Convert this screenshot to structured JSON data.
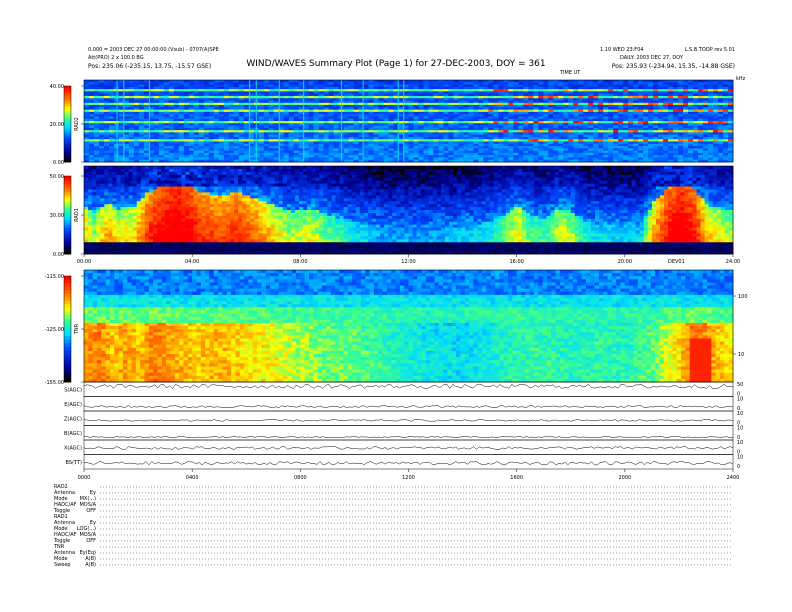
{
  "header": {
    "title": "WIND/WAVES Summary Plot (Page 1) for 27-DEC-2003, DOY = 361",
    "left_line1": "0.000 = 2003 DEC 27 00:00:00 (Vsub) - 0707(A)SPE",
    "left_line2": "Att(PRO) 2 x 100.0 BG",
    "left_pos": "Pos:    235.06 (-235.15, 13.75, -15.57 GSE)",
    "center_label": "TIME UT",
    "right_line1": "1.10 WED 23:F04",
    "right_line2": "DAILY: 2003 DEC 27, DOY",
    "right_pos": "Pos:    235.93 (-234.94, 15.35, -14.88 GSE)",
    "right_corner": "L.S.B.TOOP  rev 5.01",
    "right_unit": "kHz"
  },
  "chart_data": [
    {
      "type": "heatmap",
      "name": "RAD2",
      "ylabel": "RAD2",
      "yticks": [
        "40.00",
        "20.00",
        "0.00"
      ],
      "ylim": [
        0,
        40
      ],
      "features": {
        "horizontal_lines_frac": [
          0.12,
          0.2,
          0.28,
          0.36,
          0.5,
          0.6,
          0.72
        ],
        "vertical_streaks_hours": [
          1.2,
          1.45,
          2.4,
          6.1,
          6.35,
          7.2,
          8.1,
          9.5,
          10.3,
          11.6,
          11.8
        ]
      }
    },
    {
      "type": "heatmap",
      "name": "RAD1",
      "ylabel": "RAD1",
      "yticks": [
        "50.00",
        "30.00",
        "0.00"
      ],
      "ylim": [
        0,
        50
      ],
      "xticks": [
        "00:00",
        "04:00",
        "08:00",
        "12:00",
        "16:00",
        "20:00",
        "24:00"
      ],
      "xlim": [
        0,
        24
      ],
      "annotation": "DEV01",
      "intensity_profile": [
        [
          0.0,
          0.55
        ],
        [
          0.3,
          0.45
        ],
        [
          0.8,
          0.6
        ],
        [
          1.2,
          0.5
        ],
        [
          1.8,
          0.55
        ],
        [
          2.3,
          0.75
        ],
        [
          2.8,
          0.85
        ],
        [
          3.3,
          0.9
        ],
        [
          3.8,
          0.85
        ],
        [
          4.3,
          0.75
        ],
        [
          5.0,
          0.7
        ],
        [
          5.6,
          0.75
        ],
        [
          6.3,
          0.65
        ],
        [
          7.0,
          0.55
        ],
        [
          7.6,
          0.45
        ],
        [
          8.3,
          0.5
        ],
        [
          9.0,
          0.4
        ],
        [
          10.0,
          0.3
        ],
        [
          11.0,
          0.2
        ],
        [
          12.0,
          0.2
        ],
        [
          13.0,
          0.2
        ],
        [
          14.0,
          0.25
        ],
        [
          15.0,
          0.3
        ],
        [
          16.0,
          0.55
        ],
        [
          16.4,
          0.4
        ],
        [
          17.0,
          0.35
        ],
        [
          17.5,
          0.5
        ],
        [
          18.0,
          0.45
        ],
        [
          18.5,
          0.3
        ],
        [
          19.5,
          0.25
        ],
        [
          20.5,
          0.25
        ],
        [
          21.0,
          0.6
        ],
        [
          21.5,
          0.8
        ],
        [
          22.0,
          0.9
        ],
        [
          22.5,
          0.8
        ],
        [
          23.0,
          0.55
        ],
        [
          24.0,
          0.45
        ]
      ]
    },
    {
      "type": "heatmap",
      "name": "TNR",
      "ylabel": "TNR",
      "yticks": [
        "-115.00",
        "-125.00",
        "-155.00"
      ],
      "ylim": [
        -155,
        -115
      ],
      "right_ticks": [
        "100",
        "10"
      ],
      "intensity_profile": [
        [
          0.0,
          0.75
        ],
        [
          0.5,
          0.8
        ],
        [
          1.0,
          0.7
        ],
        [
          1.5,
          0.75
        ],
        [
          2.0,
          0.7
        ],
        [
          2.5,
          0.8
        ],
        [
          3.0,
          0.75
        ],
        [
          4.0,
          0.7
        ],
        [
          5.0,
          0.72
        ],
        [
          6.0,
          0.68
        ],
        [
          7.0,
          0.65
        ],
        [
          8.0,
          0.6
        ],
        [
          9.0,
          0.55
        ],
        [
          10.0,
          0.55
        ],
        [
          11.0,
          0.5
        ],
        [
          12.0,
          0.45
        ],
        [
          13.0,
          0.42
        ],
        [
          14.0,
          0.42
        ],
        [
          15.0,
          0.45
        ],
        [
          16.0,
          0.5
        ],
        [
          17.0,
          0.5
        ],
        [
          18.0,
          0.48
        ],
        [
          19.0,
          0.5
        ],
        [
          20.0,
          0.48
        ],
        [
          21.0,
          0.55
        ],
        [
          22.0,
          0.7
        ],
        [
          22.5,
          0.85
        ],
        [
          23.0,
          0.75
        ],
        [
          24.0,
          0.65
        ]
      ]
    },
    {
      "type": "line",
      "name": "stacked_traces",
      "xticks": [
        "0000",
        "0400",
        "0800",
        "1200",
        "1600",
        "2000",
        "2400"
      ],
      "xlim": [
        0,
        24
      ],
      "traces": [
        {
          "label": "S(AGC)",
          "rticks": [
            "50",
            "0"
          ],
          "baseline": 0.7,
          "noise": 0.15
        },
        {
          "label": "E(AGC)",
          "rticks": [
            "10",
            "0"
          ],
          "baseline": 0.3,
          "noise": 0.08
        },
        {
          "label": "Z(AGC)",
          "rticks": [
            "10",
            "0"
          ],
          "baseline": 0.35,
          "noise": 0.06
        },
        {
          "label": "B(AGC)",
          "rticks": [
            "10",
            "0"
          ],
          "baseline": 0.2,
          "noise": 0.04
        },
        {
          "label": "X(AGC)",
          "rticks": [
            "10",
            "0"
          ],
          "baseline": 0.45,
          "noise": 0.1
        },
        {
          "label": "BS(TT)",
          "rticks": [
            "10",
            "0"
          ],
          "baseline": 0.4,
          "noise": 0.12
        }
      ]
    }
  ],
  "footer_rows": [
    {
      "label": "RAD2",
      "value": ""
    },
    {
      "label": "Antenna",
      "value": "Ey"
    },
    {
      "label": "Mode",
      "value": "MX(...)"
    },
    {
      "label": "HADC/AF",
      "value": "MOS/A"
    },
    {
      "label": "Toggle",
      "value": "OFF"
    },
    {
      "label": "RAD1",
      "value": ""
    },
    {
      "label": "Antenna",
      "value": "Ey"
    },
    {
      "label": "Mode",
      "value": "LOG(...)"
    },
    {
      "label": "HADC/AF",
      "value": "MOS/A"
    },
    {
      "label": "Toggle",
      "value": "OFF"
    },
    {
      "label": "TNR",
      "value": ""
    },
    {
      "label": "Antenna",
      "value": "Ey(Eq)"
    },
    {
      "label": "Mode",
      "value": "A(B)"
    },
    {
      "label": "Sweep",
      "value": "A(B)"
    }
  ],
  "colors": {
    "black": "#000000",
    "deep_blue": "#000090",
    "blue": "#0040ff",
    "cyan": "#00e0ff",
    "green": "#40ff80",
    "yellow": "#ffff00",
    "orange": "#ff8000",
    "red": "#ff0000"
  }
}
